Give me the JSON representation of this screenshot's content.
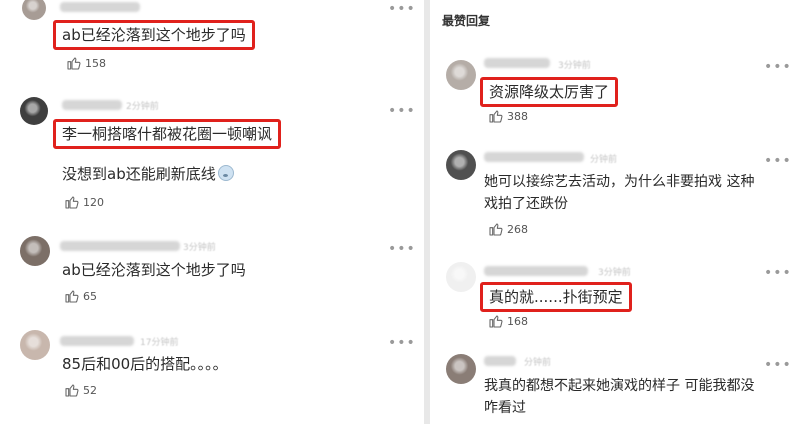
{
  "left": {
    "comments": [
      {
        "text": "ab已经沦落到这个地步了吗",
        "likes": "158",
        "avatar_color": "#a79c95"
      },
      {
        "text": "李一桐搭喀什都被花圈一顿嘲讽",
        "reply": "没想到ab还能刷新底线",
        "likes": "120",
        "time": "2分钟前",
        "avatar_color": "#3f3f3f"
      },
      {
        "text": "ab已经沦落到这个地步了吗",
        "likes": "65",
        "time": "3分钟前",
        "avatar_color": "#7c6f67"
      },
      {
        "text": "85后和00后的搭配。。。。",
        "likes": "52",
        "time": "17分钟前",
        "avatar_color": "#c8b7ad"
      }
    ]
  },
  "right": {
    "section_title": "最赞回复",
    "comments": [
      {
        "text": "资源降级太厉害了",
        "likes": "388",
        "time": "3分钟前",
        "avatar_color": "#b5ada7"
      },
      {
        "text": "她可以接综艺去活动，为什么非要拍戏 这种",
        "text2": "戏拍了还跌份",
        "likes": "268",
        "time": "分钟前",
        "avatar_color": "#505050"
      },
      {
        "text": "真的就......扑街预定",
        "likes": "168",
        "time": "3分钟前",
        "avatar_color": "#f0f0f0"
      },
      {
        "text": "我真的都想不起来她演戏的样子 可能我都没",
        "text2": "咋看过",
        "time": "分钟前",
        "avatar_color": "#8a7d76"
      }
    ]
  },
  "colors": {
    "highlight": "#e0211c",
    "divider": "#e8e8e8"
  },
  "icons": {
    "like": "thumbs-up-icon",
    "more": "more-dots-icon"
  }
}
